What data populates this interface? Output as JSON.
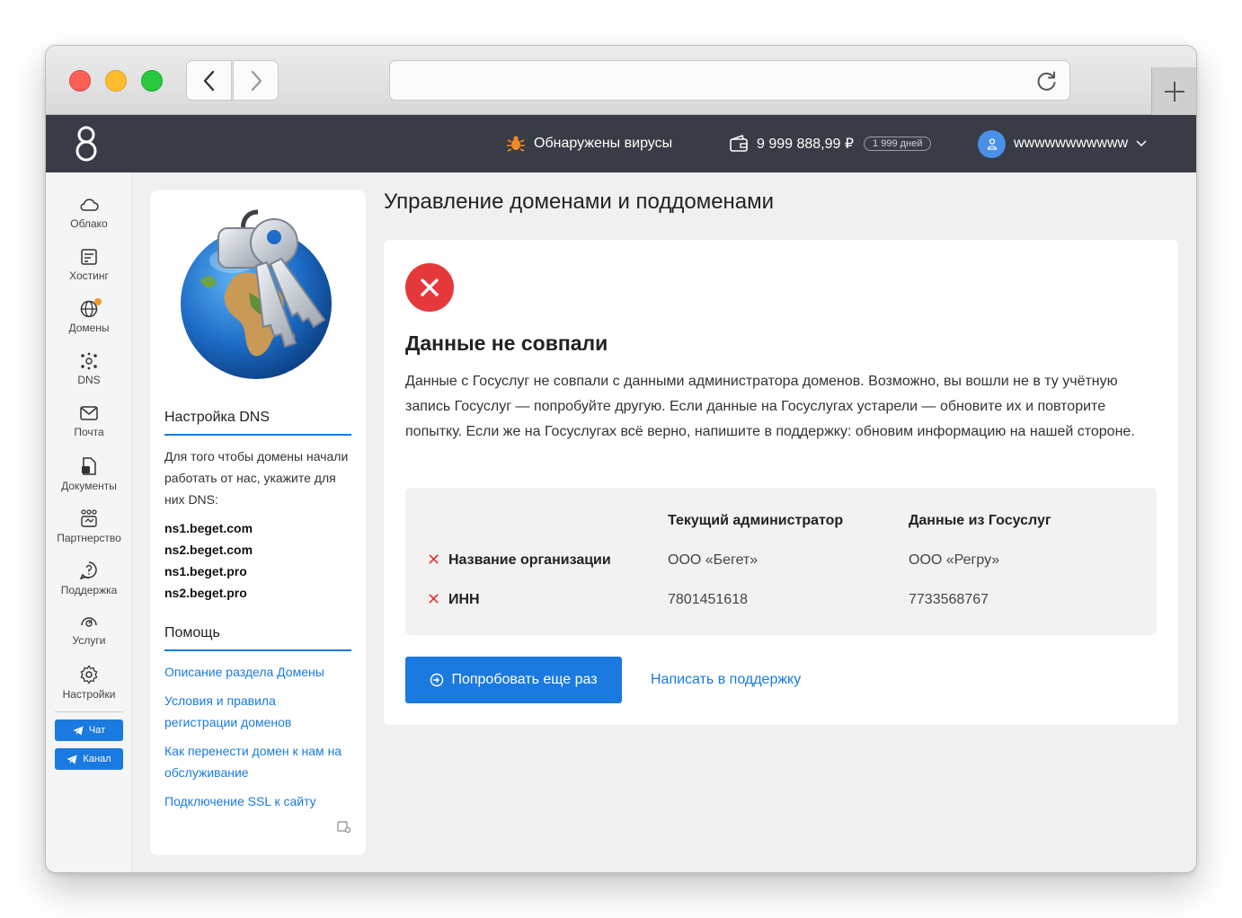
{
  "header": {
    "virus_text": "Обнаружены вирусы",
    "balance": "9 999 888,99 ₽",
    "days": "1 999 дней",
    "username": "wwwwwwwwwww"
  },
  "sidebar": {
    "items": [
      {
        "label": "Облако",
        "icon": "cloud-icon"
      },
      {
        "label": "Хостинг",
        "icon": "hosting-icon"
      },
      {
        "label": "Домены",
        "icon": "globe-icon"
      },
      {
        "label": "DNS",
        "icon": "dns-icon"
      },
      {
        "label": "Почта",
        "icon": "mail-icon"
      },
      {
        "label": "Документы",
        "icon": "documents-icon"
      },
      {
        "label": "Партнерство",
        "icon": "partnership-icon"
      },
      {
        "label": "Поддержка",
        "icon": "support-icon"
      },
      {
        "label": "Услуги",
        "icon": "services-icon"
      },
      {
        "label": "Настройки",
        "icon": "gear-icon"
      }
    ],
    "chat_label": "Чат",
    "channel_label": "Канал"
  },
  "info_panel": {
    "dns_title": "Настройка DNS",
    "dns_text": "Для того чтобы домены начали работать от нас, укажите для них DNS:",
    "nameservers": [
      "ns1.beget.com",
      "ns2.beget.com",
      "ns1.beget.pro",
      "ns2.beget.pro"
    ],
    "help_title": "Помощь",
    "help_links": [
      "Описание раздела Домены",
      "Условия и правила регистрации доменов",
      "Как перенести домен к нам на обслуживание",
      "Подключение SSL к сайту"
    ]
  },
  "main": {
    "title": "Управление доменами и поддоменами",
    "error_title": "Данные не совпали",
    "error_text": "Данные с Госуслуг не совпали с данными администратора доменов. Возможно, вы вошли не в ту учётную запись Госуслуг — попробуйте другую. Если данные на Госуслугах устарели — обновите их и повторите попытку. Если же на Госуслугах всё верно, напишите в поддержку: обновим информацию на нашей стороне.",
    "comparison": {
      "col_current": "Текущий администратор",
      "col_gosuslugi": "Данные из Госуслуг",
      "rows": [
        {
          "label": "Название организации",
          "current": "ООО «Бегет»",
          "gosuslugi": "ООО «Регру»"
        },
        {
          "label": "ИНН",
          "current": "7801451618",
          "gosuslugi": "7733568767"
        }
      ],
      "mismatch_mark": "✕"
    },
    "retry_label": "Попробовать еще раз",
    "support_label": "Написать в поддержку"
  },
  "colors": {
    "accent": "#1a7ae0",
    "error": "#e5383b",
    "topbar": "#393c46"
  }
}
